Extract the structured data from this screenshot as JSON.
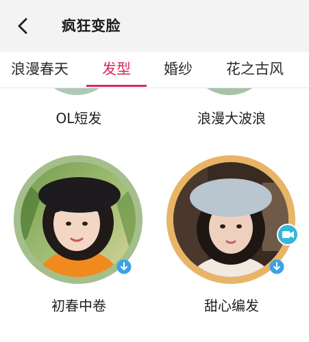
{
  "header": {
    "title": "疯狂变脸",
    "back_icon": "chevron-left-icon"
  },
  "tabs": [
    {
      "label": "浪漫春天",
      "active": false
    },
    {
      "label": "发型",
      "active": true
    },
    {
      "label": "婚纱",
      "active": false
    },
    {
      "label": "花之古风",
      "active": false
    }
  ],
  "colors": {
    "accent": "#d9285a",
    "download_badge": "#3aa3e6",
    "ring_green": "#a4bf8c",
    "ring_gold": "#e8b567"
  },
  "styles": [
    {
      "label": "OL短发",
      "download_icon": "download-icon"
    },
    {
      "label": "浪漫大波浪",
      "download_icon": "download-icon"
    },
    {
      "label": "初春中卷",
      "download_icon": "download-icon"
    },
    {
      "label": "甜心编发",
      "download_icon": "download-icon",
      "badge_icon": "video-icon"
    }
  ]
}
